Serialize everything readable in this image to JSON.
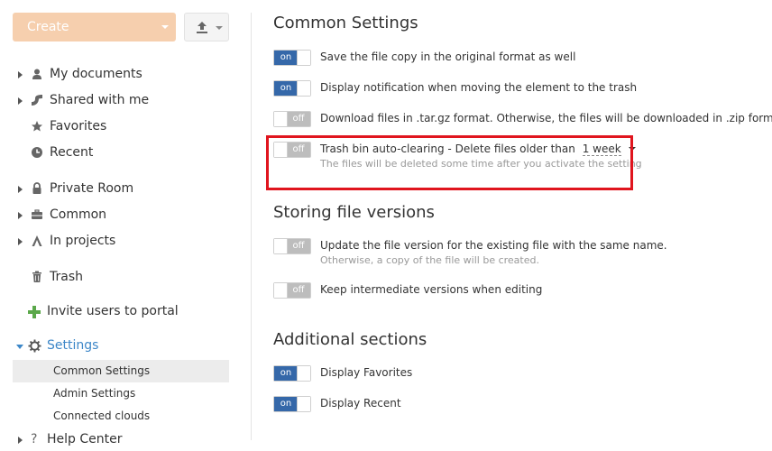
{
  "sidebar": {
    "create_label": "Create",
    "create_color": "#f6cfae",
    "nav": [
      {
        "label": "My documents",
        "icon": "user-icon"
      },
      {
        "label": "Shared with me",
        "icon": "shared-icon"
      },
      {
        "label": "Favorites",
        "icon": "star-icon"
      },
      {
        "label": "Recent",
        "icon": "clock-icon"
      },
      {
        "label": "Private Room",
        "icon": "lock-icon"
      },
      {
        "label": "Common",
        "icon": "briefcase-icon"
      },
      {
        "label": "In projects",
        "icon": "projects-icon"
      },
      {
        "label": "Trash",
        "icon": "trash-icon"
      }
    ],
    "invite_label": "Invite users to portal",
    "settings_label": "Settings",
    "settings_sub": [
      "Common Settings",
      "Admin Settings",
      "Connected clouds"
    ],
    "help_label": "Help Center",
    "accent_color": "#3d87c8"
  },
  "main": {
    "common_title": "Common Settings",
    "common": [
      {
        "label": "Save the file copy in the original format as well",
        "state": "on"
      },
      {
        "label": "Display notification when moving the element to the trash",
        "state": "on"
      },
      {
        "label": "Download files in .tar.gz format. Otherwise, the files will be downloaded in .zip format.",
        "state": "off"
      }
    ],
    "trash": {
      "label": "Trash bin auto-clearing - Delete files older than",
      "period": "1 week",
      "hint": "The files will be deleted some time after you activate the setting",
      "state": "off"
    },
    "versions_title": "Storing file versions",
    "versions": [
      {
        "label": "Update the file version for the existing file with the same name.",
        "hint": "Otherwise, a copy of the file will be created.",
        "state": "off"
      },
      {
        "label": "Keep intermediate versions when editing",
        "state": "off"
      }
    ],
    "additional_title": "Additional sections",
    "additional": [
      {
        "label": "Display Favorites",
        "state": "on"
      },
      {
        "label": "Display Recent",
        "state": "on"
      }
    ],
    "toggle_on_text": "on",
    "toggle_off_text": "off",
    "toggle_on_color": "#3568a9",
    "highlight_color": "#e0151e"
  }
}
